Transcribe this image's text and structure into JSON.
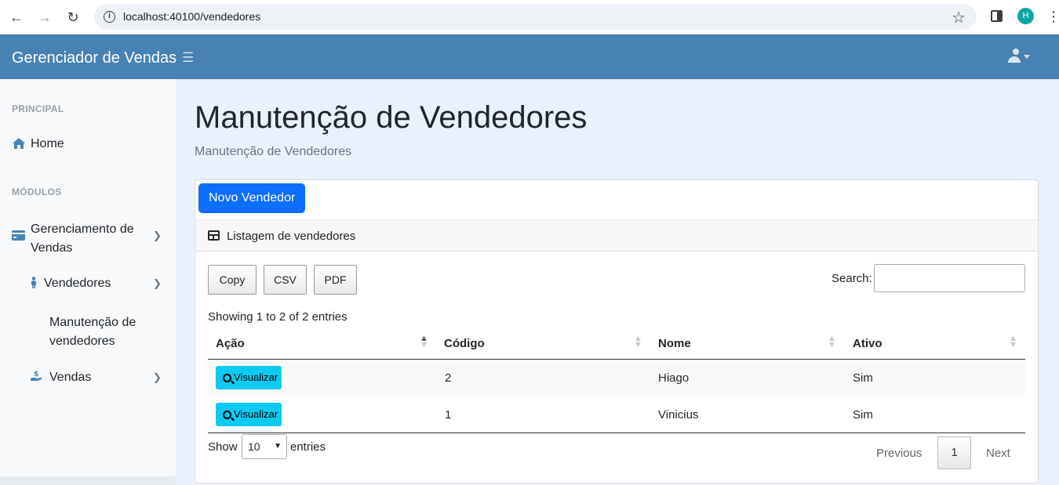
{
  "browser": {
    "url": "localhost:40100/vendedores",
    "profile_initial": "H"
  },
  "navbar": {
    "brand": "Gerenciador de Vendas"
  },
  "sidebar": {
    "heading_principal": "PRINCIPAL",
    "home": "Home",
    "heading_modulos": "MÓDULOS",
    "gerenciamento_line1": "Gerenciamento de",
    "gerenciamento_line2": "Vendas",
    "vendedores": "Vendedores",
    "manutencao_line1": "Manutenção de",
    "manutencao_line2": "vendedores",
    "vendas": "Vendas"
  },
  "page": {
    "title": "Manutenção de Vendedores",
    "subtitle": "Manutenção de Vendedores"
  },
  "card": {
    "new_button": "Novo Vendedor",
    "header": "Listagem de vendedores"
  },
  "datatable": {
    "buttons": [
      "Copy",
      "CSV",
      "PDF"
    ],
    "search_label": "Search:",
    "search_value": "",
    "info": "Showing 1 to 2 of 2 entries",
    "columns": [
      "Ação",
      "Código",
      "Nome",
      "Ativo"
    ],
    "rows": [
      {
        "action": "Visualizar",
        "codigo": "2",
        "nome": "Hiago",
        "ativo": "Sim"
      },
      {
        "action": "Visualizar",
        "codigo": "1",
        "nome": "Vinicius",
        "ativo": "Sim"
      }
    ],
    "show_label": "Show",
    "page_length": "10",
    "entries_label": "entries",
    "previous": "Previous",
    "current_page": "1",
    "next": "Next"
  },
  "colors": {
    "navbar": "#4682b4",
    "primary_button": "#0d6efd",
    "view_button": "#0dcaf0",
    "main_background": "#e8f1fc"
  }
}
